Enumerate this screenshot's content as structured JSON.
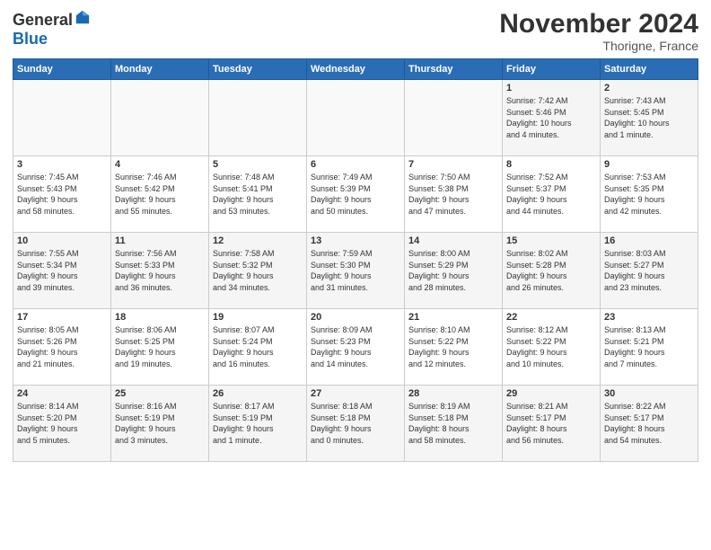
{
  "logo": {
    "general": "General",
    "blue": "Blue"
  },
  "header": {
    "month": "November 2024",
    "location": "Thorigne, France"
  },
  "weekdays": [
    "Sunday",
    "Monday",
    "Tuesday",
    "Wednesday",
    "Thursday",
    "Friday",
    "Saturday"
  ],
  "weeks": [
    [
      {
        "day": "",
        "info": ""
      },
      {
        "day": "",
        "info": ""
      },
      {
        "day": "",
        "info": ""
      },
      {
        "day": "",
        "info": ""
      },
      {
        "day": "",
        "info": ""
      },
      {
        "day": "1",
        "info": "Sunrise: 7:42 AM\nSunset: 5:46 PM\nDaylight: 10 hours\nand 4 minutes."
      },
      {
        "day": "2",
        "info": "Sunrise: 7:43 AM\nSunset: 5:45 PM\nDaylight: 10 hours\nand 1 minute."
      }
    ],
    [
      {
        "day": "3",
        "info": "Sunrise: 7:45 AM\nSunset: 5:43 PM\nDaylight: 9 hours\nand 58 minutes."
      },
      {
        "day": "4",
        "info": "Sunrise: 7:46 AM\nSunset: 5:42 PM\nDaylight: 9 hours\nand 55 minutes."
      },
      {
        "day": "5",
        "info": "Sunrise: 7:48 AM\nSunset: 5:41 PM\nDaylight: 9 hours\nand 53 minutes."
      },
      {
        "day": "6",
        "info": "Sunrise: 7:49 AM\nSunset: 5:39 PM\nDaylight: 9 hours\nand 50 minutes."
      },
      {
        "day": "7",
        "info": "Sunrise: 7:50 AM\nSunset: 5:38 PM\nDaylight: 9 hours\nand 47 minutes."
      },
      {
        "day": "8",
        "info": "Sunrise: 7:52 AM\nSunset: 5:37 PM\nDaylight: 9 hours\nand 44 minutes."
      },
      {
        "day": "9",
        "info": "Sunrise: 7:53 AM\nSunset: 5:35 PM\nDaylight: 9 hours\nand 42 minutes."
      }
    ],
    [
      {
        "day": "10",
        "info": "Sunrise: 7:55 AM\nSunset: 5:34 PM\nDaylight: 9 hours\nand 39 minutes."
      },
      {
        "day": "11",
        "info": "Sunrise: 7:56 AM\nSunset: 5:33 PM\nDaylight: 9 hours\nand 36 minutes."
      },
      {
        "day": "12",
        "info": "Sunrise: 7:58 AM\nSunset: 5:32 PM\nDaylight: 9 hours\nand 34 minutes."
      },
      {
        "day": "13",
        "info": "Sunrise: 7:59 AM\nSunset: 5:30 PM\nDaylight: 9 hours\nand 31 minutes."
      },
      {
        "day": "14",
        "info": "Sunrise: 8:00 AM\nSunset: 5:29 PM\nDaylight: 9 hours\nand 28 minutes."
      },
      {
        "day": "15",
        "info": "Sunrise: 8:02 AM\nSunset: 5:28 PM\nDaylight: 9 hours\nand 26 minutes."
      },
      {
        "day": "16",
        "info": "Sunrise: 8:03 AM\nSunset: 5:27 PM\nDaylight: 9 hours\nand 23 minutes."
      }
    ],
    [
      {
        "day": "17",
        "info": "Sunrise: 8:05 AM\nSunset: 5:26 PM\nDaylight: 9 hours\nand 21 minutes."
      },
      {
        "day": "18",
        "info": "Sunrise: 8:06 AM\nSunset: 5:25 PM\nDaylight: 9 hours\nand 19 minutes."
      },
      {
        "day": "19",
        "info": "Sunrise: 8:07 AM\nSunset: 5:24 PM\nDaylight: 9 hours\nand 16 minutes."
      },
      {
        "day": "20",
        "info": "Sunrise: 8:09 AM\nSunset: 5:23 PM\nDaylight: 9 hours\nand 14 minutes."
      },
      {
        "day": "21",
        "info": "Sunrise: 8:10 AM\nSunset: 5:22 PM\nDaylight: 9 hours\nand 12 minutes."
      },
      {
        "day": "22",
        "info": "Sunrise: 8:12 AM\nSunset: 5:22 PM\nDaylight: 9 hours\nand 10 minutes."
      },
      {
        "day": "23",
        "info": "Sunrise: 8:13 AM\nSunset: 5:21 PM\nDaylight: 9 hours\nand 7 minutes."
      }
    ],
    [
      {
        "day": "24",
        "info": "Sunrise: 8:14 AM\nSunset: 5:20 PM\nDaylight: 9 hours\nand 5 minutes."
      },
      {
        "day": "25",
        "info": "Sunrise: 8:16 AM\nSunset: 5:19 PM\nDaylight: 9 hours\nand 3 minutes."
      },
      {
        "day": "26",
        "info": "Sunrise: 8:17 AM\nSunset: 5:19 PM\nDaylight: 9 hours\nand 1 minute."
      },
      {
        "day": "27",
        "info": "Sunrise: 8:18 AM\nSunset: 5:18 PM\nDaylight: 9 hours\nand 0 minutes."
      },
      {
        "day": "28",
        "info": "Sunrise: 8:19 AM\nSunset: 5:18 PM\nDaylight: 8 hours\nand 58 minutes."
      },
      {
        "day": "29",
        "info": "Sunrise: 8:21 AM\nSunset: 5:17 PM\nDaylight: 8 hours\nand 56 minutes."
      },
      {
        "day": "30",
        "info": "Sunrise: 8:22 AM\nSunset: 5:17 PM\nDaylight: 8 hours\nand 54 minutes."
      }
    ]
  ]
}
